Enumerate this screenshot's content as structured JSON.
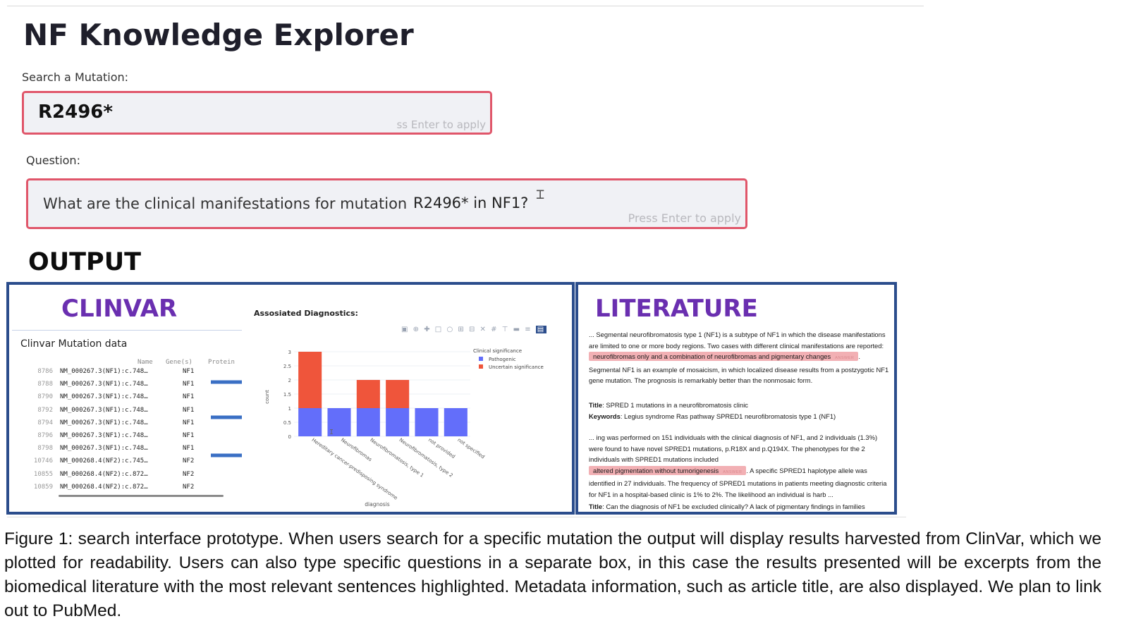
{
  "app": {
    "title": "NF Knowledge Explorer"
  },
  "search": {
    "label": "Search a Mutation:",
    "value": "R2496*",
    "hint": "ss Enter to apply"
  },
  "question": {
    "label": "Question:",
    "value_prefix": "What are the clinical manifestations for mutation",
    "value_mutation": "R2496* in NF1?",
    "hint": "Press Enter to apply"
  },
  "output": {
    "heading": "OUTPUT"
  },
  "clinvar": {
    "title": "CLINVAR",
    "table_title": "Clinvar Mutation data",
    "columns": [
      "Name",
      "Gene(s)",
      "Protein"
    ],
    "rows": [
      {
        "idx": "8786",
        "name": "NM_000267.3(NF1):c.748…",
        "gene": "NF1"
      },
      {
        "idx": "8788",
        "name": "NM_000267.3(NF1):c.748…",
        "gene": "NF1"
      },
      {
        "idx": "8790",
        "name": "NM_000267.3(NF1):c.748…",
        "gene": "NF1"
      },
      {
        "idx": "8792",
        "name": "NM_000267.3(NF1):c.748…",
        "gene": "NF1"
      },
      {
        "idx": "8794",
        "name": "NM_000267.3(NF1):c.748…",
        "gene": "NF1"
      },
      {
        "idx": "8796",
        "name": "NM_000267.3(NF1):c.748…",
        "gene": "NF1"
      },
      {
        "idx": "8798",
        "name": "NM_000267.3(NF1):c.748…",
        "gene": "NF1"
      },
      {
        "idx": "10746",
        "name": "NM_000268.4(NF2):c.745…",
        "gene": "NF2"
      },
      {
        "idx": "10855",
        "name": "NM_000268.4(NF2):c.872…",
        "gene": "NF2"
      },
      {
        "idx": "10859",
        "name": "NM_000268.4(NF2):c.872…",
        "gene": "NF2"
      }
    ],
    "chart_title": "Assosiated Diagnostics:",
    "colors": {
      "pathogenic": "#636efa",
      "uncertain": "#ef553b",
      "arrow": "#3a6fc4"
    }
  },
  "chart_data": {
    "type": "bar",
    "stacked": true,
    "categories": [
      "Hereditary cancer-predisposing syndrome",
      "Neurofibromas",
      "Neurofibromatosis, type 1",
      "Neurofibromatosis, type 2",
      "not provided",
      "not specified"
    ],
    "series": [
      {
        "name": "Pathogenic",
        "color": "#636efa",
        "values": [
          1,
          1,
          1,
          1,
          1,
          1
        ]
      },
      {
        "name": "Uncertain significance",
        "color": "#ef553b",
        "values": [
          2,
          0,
          1,
          1,
          0,
          0
        ]
      }
    ],
    "xlabel": "diagnosis",
    "ylabel": "count",
    "yticks": [
      "0",
      "0.5",
      "1",
      "1.5",
      "2",
      "2.5",
      "3"
    ],
    "ylim": [
      0,
      3
    ],
    "legend_title": "Clinical significance",
    "legend_position": "top-right"
  },
  "literature": {
    "title": "LITERATURE",
    "p1_a": "... Segmental neurofibromatosis type 1 (NF1) is a subtype of NF1 in which the disease manifestations are limited to one or more body regions. Two cases with different clinical manifestations are reported:",
    "p1_hl": "neurofibromas only and a combination of neurofibromas and pigmentary changes",
    "answer_tag": "ANSWER",
    "p1_b": "Segmental NF1 is an example of mosaicism, in which localized disease results from a postzygotic NF1 gene mutation. The prognosis is remarkably better than the nonmosaic form.",
    "title_label": "Title",
    "title_1": "SPRED 1 mutations in a neurofibromatosis clinic",
    "keywords_label": "Keywords",
    "keywords_1": "Legius syndrome Ras pathway SPRED1 neurofibromatosis type 1 (NF1)",
    "p2_a": "... ing was performed on 151 individuals with the clinical diagnosis of NF1, and 2 individuals (1.3%) were found to have novel SPRED1 mutations, p.R18X and p.Q194X. The phenotypes for the 2 individuals with SPRED1 mutations included",
    "p2_hl": "altered pigmentation without tumorigenesis",
    "p2_b": ". A specific SPRED1 haplotype allele was identified in 27 individuals. The frequency of SPRED1 mutations in patients meeting diagnostic criteria for NF1 in a hospital-based clinic is 1% to 2%. The likelihood an individual is harb ...",
    "title_2": "Can the diagnosis of NF1 be excluded clinically? A lack of pigmentary findings in families"
  },
  "caption": "Figure 1: search interface prototype. When users search for a specific mutation the output will display results harvested from ClinVar, which we plotted for readability. Users can also type specific questions in a separate box, in this case the results presented will be excerpts from the  biomedical literature with the most relevant sentences highlighted. Metadata information, such as article title, are also displayed. We plan to link out to PubMed."
}
